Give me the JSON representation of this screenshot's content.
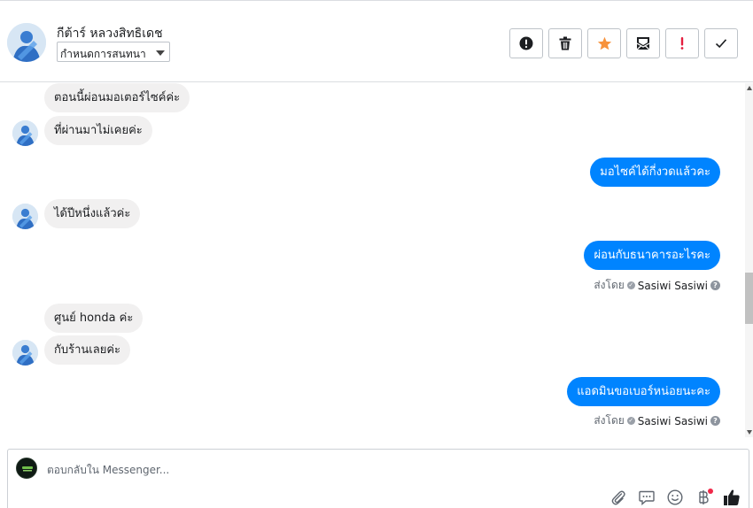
{
  "header": {
    "contact_name": "กีต้าร์ หลวงสิทธิเดช",
    "status_select": "กำหนดการสนทนา",
    "actions": [
      {
        "name": "spam-button",
        "icon": "exclamation-circle-icon"
      },
      {
        "name": "delete-button",
        "icon": "trash-icon"
      },
      {
        "name": "star-button",
        "icon": "star-icon",
        "color": "#f7923b"
      },
      {
        "name": "mark-unread-button",
        "icon": "envelope-icon"
      },
      {
        "name": "follow-up-button",
        "icon": "exclamation-icon",
        "color": "#e41e3f"
      },
      {
        "name": "done-button",
        "icon": "checkmark-icon"
      }
    ]
  },
  "messages": [
    {
      "from": "customer",
      "text": "ตอนนี้ผ่อนมอเตอร์ไซค์ค่ะ"
    },
    {
      "from": "customer",
      "text": "ที่ผ่านมาไม่เคยค่ะ"
    },
    {
      "from": "page",
      "text": "มอไซค์ได้กี่งวดแล้วคะ"
    },
    {
      "from": "customer",
      "text": "ได้ปีหนึ่งแล้วค่ะ"
    },
    {
      "from": "page",
      "text": "ผ่อนกับธนาคารอะไรคะ"
    },
    {
      "from": "customer",
      "text": "ศูนย์ honda ค่ะ"
    },
    {
      "from": "customer",
      "text": "กับร้านเลยค่ะ"
    },
    {
      "from": "page",
      "text": "แอดมินขอเบอร์หน่อยนะคะ"
    }
  ],
  "sent_by": {
    "prefix": "ส่งโดย",
    "sender": "Sasiwi Sasiwi"
  },
  "composer": {
    "placeholder": "ตอบกลับใน Messenger..."
  },
  "colors": {
    "outgoing_bubble": "#0084ff",
    "incoming_bubble": "#f1f0f0",
    "like_icon": "#1c1e21"
  }
}
